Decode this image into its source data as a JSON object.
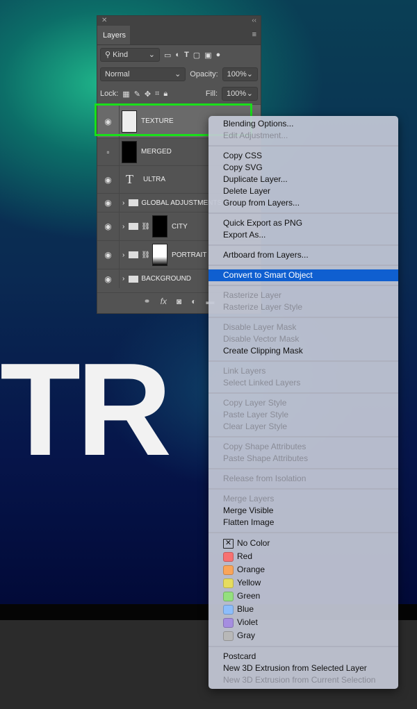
{
  "canvas": {
    "big_text": "TR"
  },
  "panel": {
    "title": "Layers",
    "filter": "Kind",
    "blend_mode": "Normal",
    "opacity_label": "Opacity:",
    "opacity": "100%",
    "lock_label": "Lock:",
    "fill_label": "Fill:",
    "fill": "100%",
    "layers": [
      {
        "name": "TEXTURE",
        "visible": true,
        "selected": true
      },
      {
        "name": "MERGED",
        "visible": false
      },
      {
        "name": "ULTRA",
        "visible": true,
        "type": "text"
      },
      {
        "name": "GLOBAL ADJUSTMENTS",
        "visible": true,
        "type": "group"
      },
      {
        "name": "CITY",
        "visible": true,
        "type": "group"
      },
      {
        "name": "PORTRAIT",
        "visible": true,
        "type": "group"
      },
      {
        "name": "BACKGROUND",
        "visible": true,
        "type": "group"
      }
    ]
  },
  "menu": {
    "groups": [
      [
        {
          "label": "Blending Options..."
        },
        {
          "label": "Edit Adjustment...",
          "disabled": true
        }
      ],
      [
        {
          "label": "Copy CSS"
        },
        {
          "label": "Copy SVG"
        },
        {
          "label": "Duplicate Layer..."
        },
        {
          "label": "Delete Layer"
        },
        {
          "label": "Group from Layers..."
        }
      ],
      [
        {
          "label": "Quick Export as PNG"
        },
        {
          "label": "Export As..."
        }
      ],
      [
        {
          "label": "Artboard from Layers..."
        }
      ],
      [
        {
          "label": "Convert to Smart Object",
          "highlighted": true
        }
      ],
      [
        {
          "label": "Rasterize Layer",
          "disabled": true
        },
        {
          "label": "Rasterize Layer Style",
          "disabled": true
        }
      ],
      [
        {
          "label": "Disable Layer Mask",
          "disabled": true
        },
        {
          "label": "Disable Vector Mask",
          "disabled": true
        },
        {
          "label": "Create Clipping Mask"
        }
      ],
      [
        {
          "label": "Link Layers",
          "disabled": true
        },
        {
          "label": "Select Linked Layers",
          "disabled": true
        }
      ],
      [
        {
          "label": "Copy Layer Style",
          "disabled": true
        },
        {
          "label": "Paste Layer Style",
          "disabled": true
        },
        {
          "label": "Clear Layer Style",
          "disabled": true
        }
      ],
      [
        {
          "label": "Copy Shape Attributes",
          "disabled": true
        },
        {
          "label": "Paste Shape Attributes",
          "disabled": true
        }
      ],
      [
        {
          "label": "Release from Isolation",
          "disabled": true
        }
      ],
      [
        {
          "label": "Merge Layers",
          "disabled": true
        },
        {
          "label": "Merge Visible"
        },
        {
          "label": "Flatten Image"
        }
      ]
    ],
    "colors": [
      {
        "label": "No Color",
        "color": "none"
      },
      {
        "label": "Red",
        "color": "#f87171"
      },
      {
        "label": "Orange",
        "color": "#f9a55a"
      },
      {
        "label": "Yellow",
        "color": "#e6dc5e"
      },
      {
        "label": "Green",
        "color": "#94e07e"
      },
      {
        "label": "Blue",
        "color": "#8dbdfa"
      },
      {
        "label": "Violet",
        "color": "#a58ee0"
      },
      {
        "label": "Gray",
        "color": "#b8b8b8"
      }
    ],
    "tail": [
      {
        "label": "Postcard"
      },
      {
        "label": "New 3D Extrusion from Selected Layer"
      },
      {
        "label": "New 3D Extrusion from Current Selection",
        "disabled": true
      }
    ]
  },
  "highlight_color": "#19e019"
}
